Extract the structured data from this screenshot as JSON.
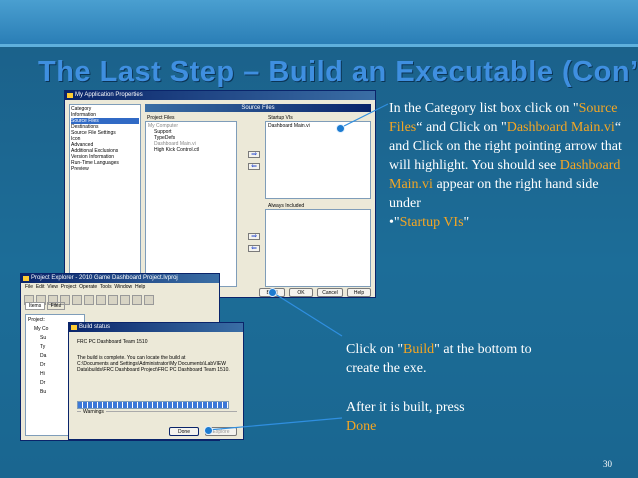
{
  "slide": {
    "title": "The Last Step – Build an Executable (Con’t)",
    "page_number": "30"
  },
  "app_properties": {
    "window_title": "My Application Properties",
    "category_header": "Category",
    "categories": [
      "Information",
      "Source Files",
      "Destinations",
      "Source File Settings",
      "Icon",
      "Advanced",
      "Additional Exclusions",
      "Version Information",
      "Run-Time Languages",
      "Preview"
    ],
    "selected_category": "Source Files",
    "section_title": "Source Files",
    "project_files_label": "Project Files",
    "project_tree": [
      "My Computer",
      "Support",
      "TypeDefs",
      "Dashboard Main.vi",
      "High Kick Control.ctl"
    ],
    "startup_label": "Startup VIs",
    "startup_items": [
      "Dashboard Main.vi"
    ],
    "always_label": "Always Included",
    "buttons": {
      "build": "Build",
      "ok": "OK",
      "cancel": "Cancel",
      "help": "Help"
    }
  },
  "project_explorer": {
    "window_title": "Project Explorer - 2010 Game Dashboard Project.lvproj",
    "menu": [
      "File",
      "Edit",
      "View",
      "Project",
      "Operate",
      "Tools",
      "Window",
      "Help"
    ],
    "tabs": [
      "Items",
      "Files"
    ],
    "tree": [
      "Project:",
      "My Co",
      "Su",
      "Ty",
      "Da",
      "Dr",
      "Hi",
      "Dr",
      "Bu"
    ]
  },
  "build_status": {
    "window_title": "Build status",
    "build_name": "FRC PC Dashboard Team 1510",
    "message": "The build is complete. You can locate the build at\nC:\\Documents and Settings\\Administrator\\My Documents\\LabVIEW Data\\builds\\FRC Dashboard Project\\FRC PC Dashboard Team 1510.",
    "warnings_label": "Warnings",
    "progress": 1.0,
    "buttons": {
      "done": "Done",
      "explore": "Explore"
    }
  },
  "caption1": {
    "p1": "In the Category list box click on \"",
    "h1": "Source Files",
    "p2": "“ and Click on \"",
    "h2": "Dashboard Main.vi",
    "p3": "“ and Click on the right pointing arrow that will highlight. You should see ",
    "h3": "Dashboard Main.vi",
    "p4": " appear on the right hand side under",
    "p5": "•\"",
    "h4": "Startup VIs",
    "p6": "\""
  },
  "caption2": {
    "p1": "Click on \"",
    "h1": "Build",
    "p2": "\" at the bottom to create the exe.",
    "p3": "After it is built, press",
    "h2": "Done"
  },
  "colors": {
    "highlight": "#f5a623",
    "title": "#3f8fe0",
    "background": "#1c6d98"
  }
}
